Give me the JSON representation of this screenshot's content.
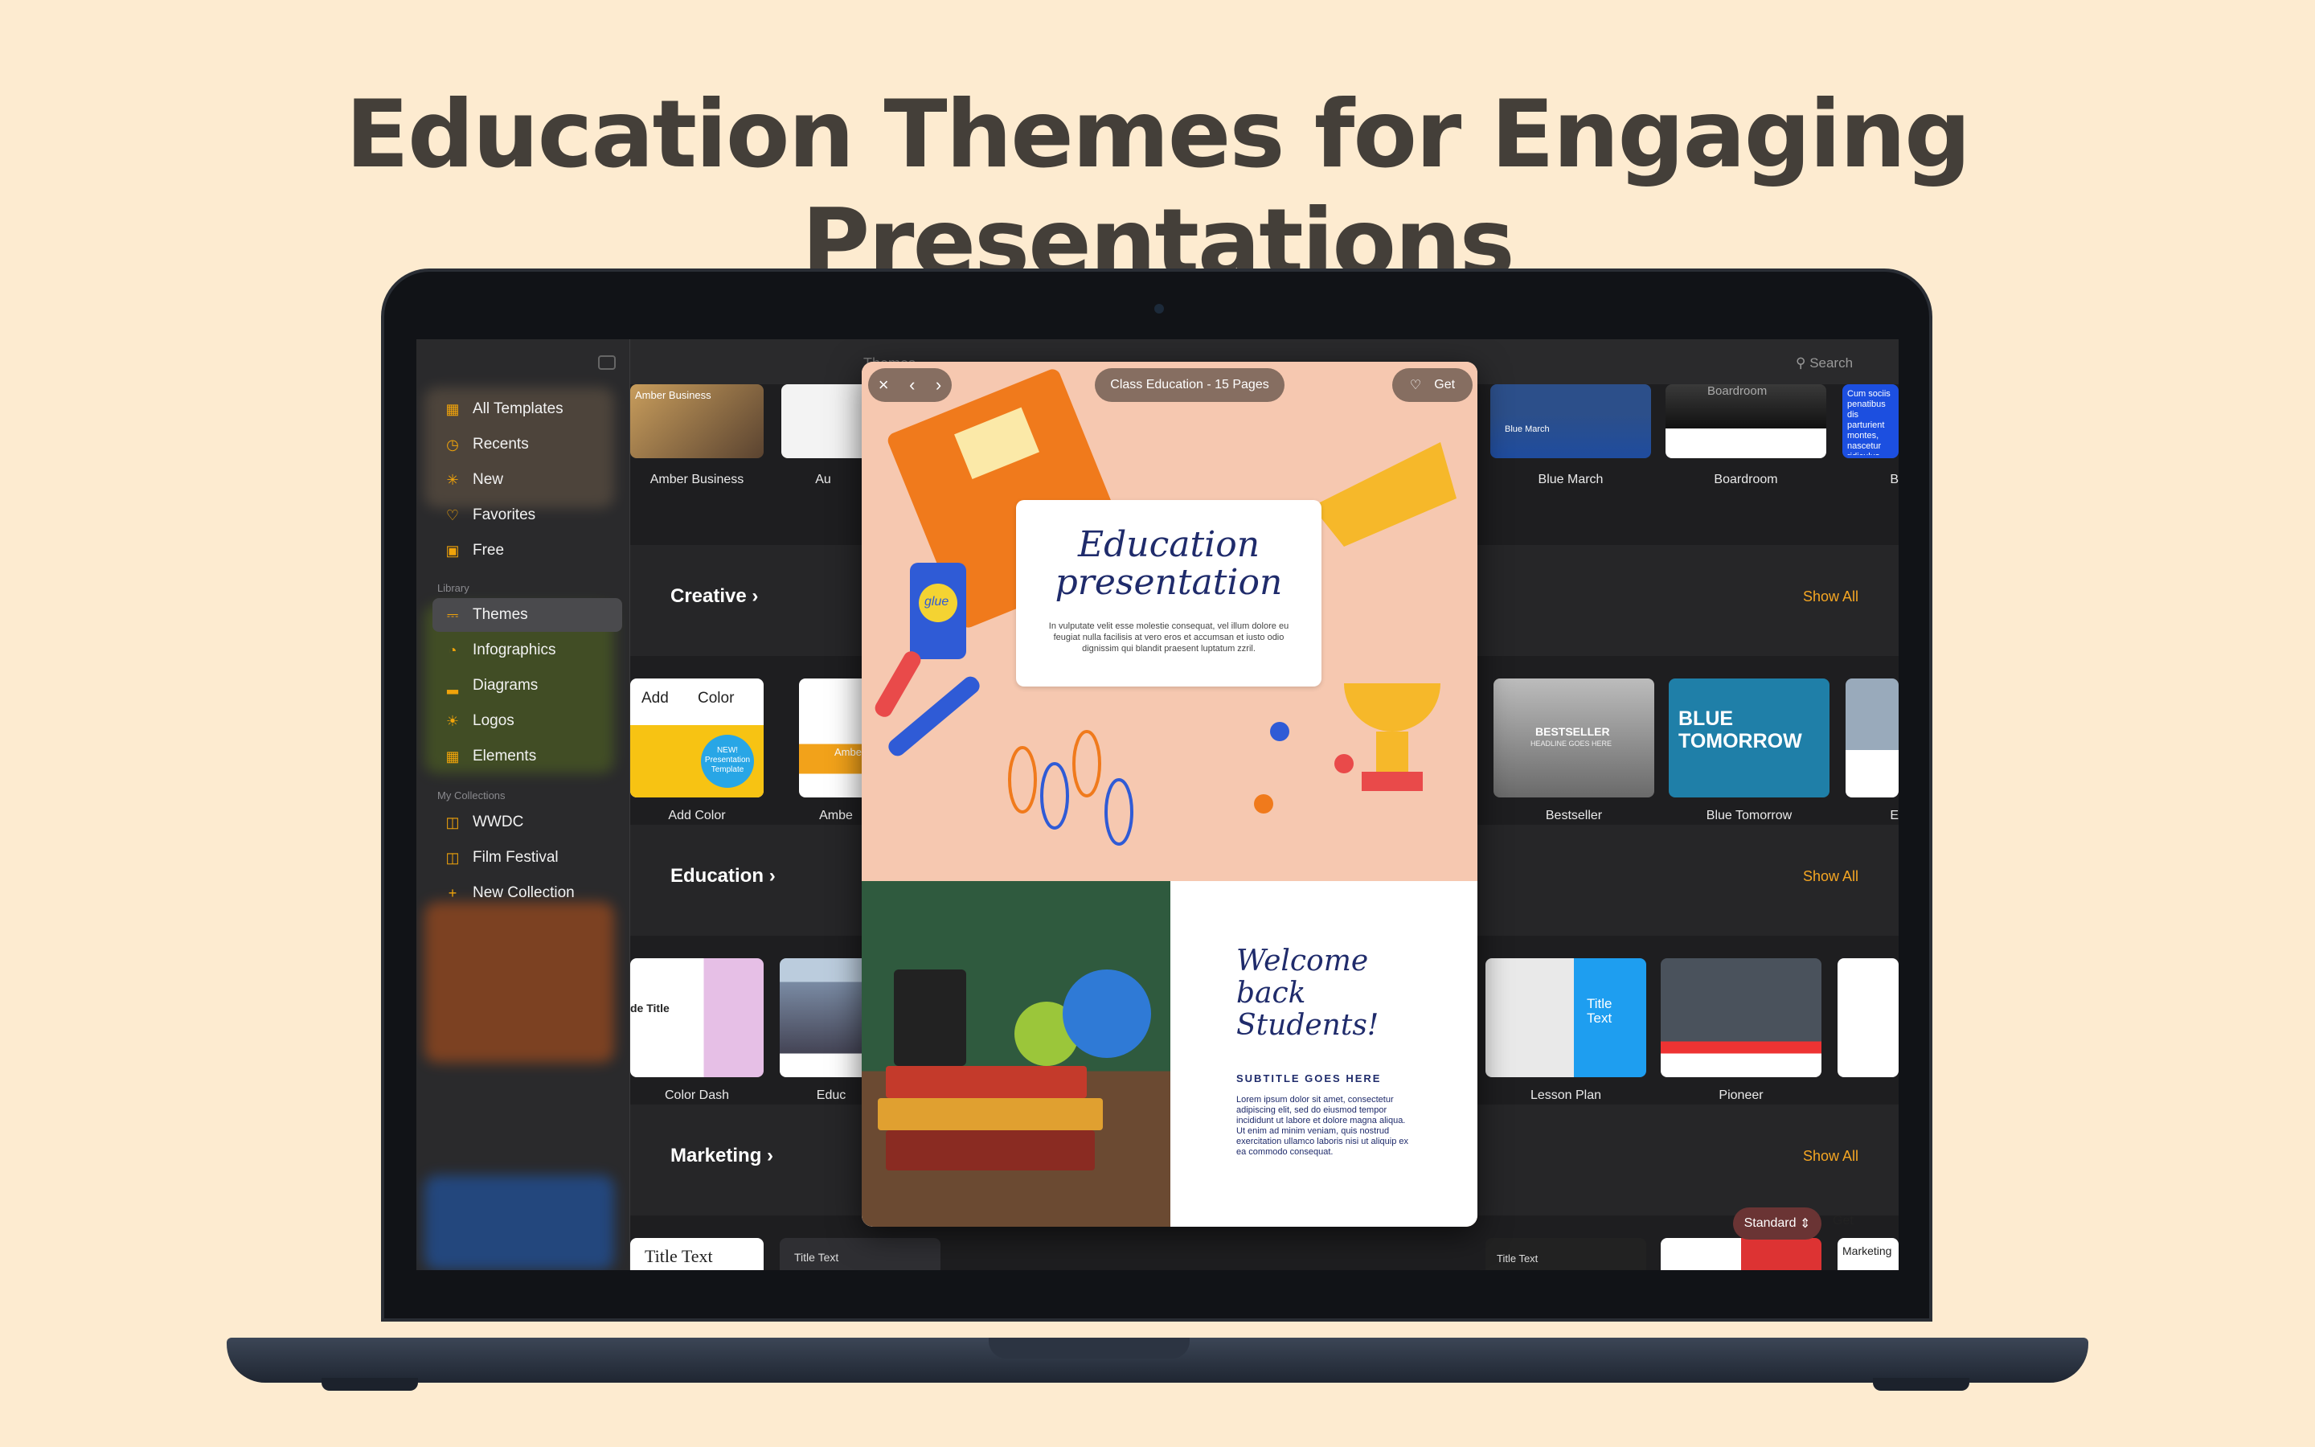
{
  "headline": "Education Themes for Engaging Presentations",
  "topbar": {
    "title": "Themes",
    "search_label": "Search"
  },
  "sidebar": {
    "items": [
      {
        "label": "All Templates",
        "icon": "grid-icon"
      },
      {
        "label": "Recents",
        "icon": "clock-icon"
      },
      {
        "label": "New",
        "icon": "sparkle-icon"
      },
      {
        "label": "Favorites",
        "icon": "heart-icon"
      },
      {
        "label": "Free",
        "icon": "bag-icon"
      }
    ],
    "library_label": "Library",
    "library": [
      {
        "label": "Themes",
        "icon": "easel-icon",
        "active": true
      },
      {
        "label": "Infographics",
        "icon": "chart-pie-icon"
      },
      {
        "label": "Diagrams",
        "icon": "bar-chart-icon"
      },
      {
        "label": "Logos",
        "icon": "lightbulb-icon"
      },
      {
        "label": "Elements",
        "icon": "squares-icon"
      }
    ],
    "collections_label": "My Collections",
    "collections": [
      {
        "label": "WWDC",
        "icon": "folder-icon"
      },
      {
        "label": "Film Festival",
        "icon": "folder-icon"
      },
      {
        "label": "New Collection",
        "icon": "plus-icon"
      }
    ]
  },
  "sections": [
    {
      "title": "Creative",
      "show_all": "Show All"
    },
    {
      "title": "Education",
      "show_all": "Show All"
    },
    {
      "title": "Marketing",
      "show_all": "Show All"
    }
  ],
  "top_row": [
    "Amber Business",
    "Au",
    "Blue March",
    "Boardroom",
    "B"
  ],
  "creative_row": [
    "Add Color",
    "Ambe",
    "Bestseller",
    "Blue Tomorrow",
    "E"
  ],
  "education_row": [
    "Color Dash",
    "Educ",
    "Lesson Plan",
    "Pioneer"
  ],
  "card_text": {
    "amber": "Amber Business",
    "blue_march": "Blue March",
    "boardroom": "Boardroom",
    "cum": "Cum sociis penatibus dis parturient montes, nascetur ridiculus mus",
    "add_color_a": "Add",
    "add_color_b": "Color",
    "new_badge": "NEW! Presentation Template",
    "amb": "Ambe",
    "bestseller": "BESTSELLER",
    "bestseller_sub": "HEADLINE GOES HERE",
    "blue_tomorrow": "BLUE TOMORROW",
    "de_title": "de Title",
    "title_text": "Title Text",
    "title_text_upper": "TITLE TEXT",
    "marketing": "Marketing"
  },
  "modal": {
    "badge": "Class Education - 15 Pages",
    "get": "Get",
    "title_line1": "Education",
    "title_line2": "presentation",
    "body": "In vulputate velit esse molestie consequat, vel illum dolore eu feugiat nulla facilisis at vero eros et accumsan et iusto odio dignissim qui blandit praesent luptatum zzril.",
    "glue": "glue",
    "welcome": "Welcome back Students!",
    "subtitle": "SUBTITLE GOES HERE",
    "body2": "Lorem ipsum dolor sit amet, consectetur adipiscing elit, sed do eiusmod tempor incididunt ut labore et dolore magna aliqua. Ut enim ad minim veniam, quis nostrud exercitation ullamco laboris nisi ut aliquip ex ea commodo consequat."
  },
  "footer_controls": {
    "standard": "Standard",
    "get": "Get"
  },
  "colors": {
    "accent": "#f5a623",
    "background": "#fdebd0",
    "sidebar": "#2a2a2c"
  }
}
